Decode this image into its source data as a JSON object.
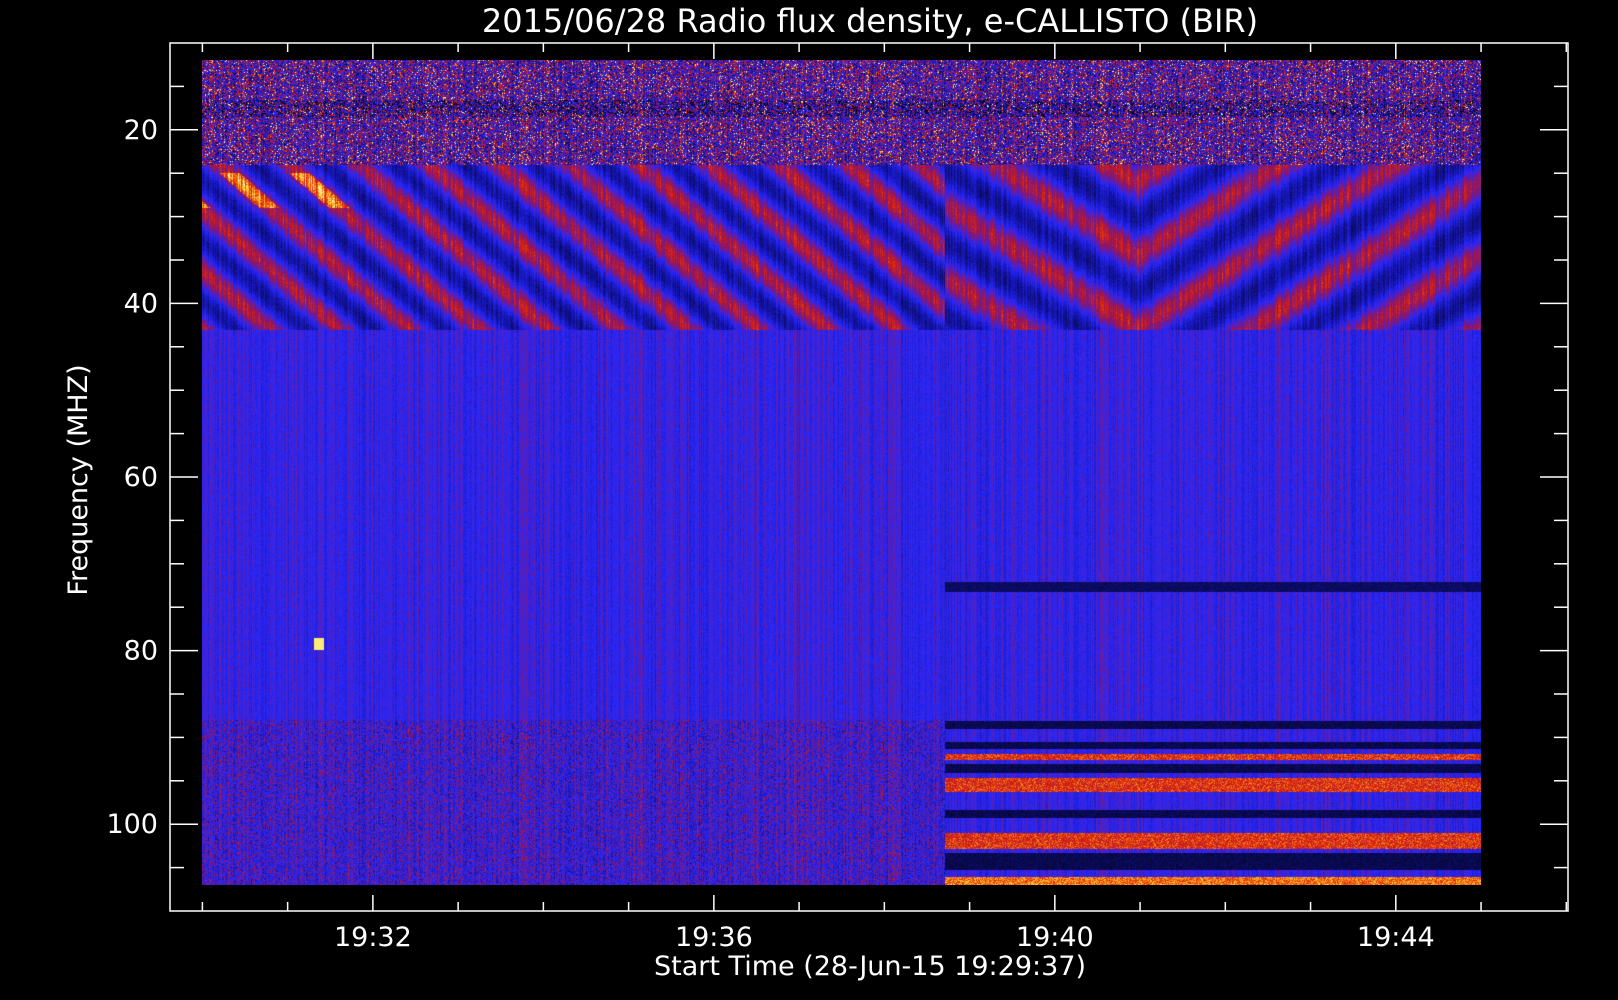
{
  "chart_data": {
    "type": "heatmap",
    "title": "2015/06/28  Radio flux density, e-CALLISTO (BIR)",
    "xlabel": "Start Time (28-Jun-15 19:29:37)",
    "ylabel": "Frequency (MHZ)",
    "x_start": "19:29:37",
    "x_end": "19:45:00",
    "xlim_minutes": [
      0,
      16.4
    ],
    "ylim": [
      10,
      110
    ],
    "y_inverted": true,
    "x_ticks": [
      {
        "label": "19:32",
        "minute": 2.38
      },
      {
        "label": "19:36",
        "minute": 6.38
      },
      {
        "label": "19:40",
        "minute": 10.38
      },
      {
        "label": "19:44",
        "minute": 14.38
      }
    ],
    "y_ticks": [
      {
        "label": "20",
        "value": 20
      },
      {
        "label": "40",
        "value": 40
      },
      {
        "label": "60",
        "value": 60
      },
      {
        "label": "80",
        "value": 80
      },
      {
        "label": "100",
        "value": 100
      }
    ],
    "data_extent": {
      "minute_start": 0.38,
      "minute_end": 15.38,
      "freq_start": 12,
      "freq_end": 107
    },
    "segment_break_minute": 9.08,
    "grid": false,
    "colormap": [
      "#000000",
      "#1414c8",
      "#2828ff",
      "#b01010",
      "#ff3300",
      "#ffff66"
    ]
  }
}
